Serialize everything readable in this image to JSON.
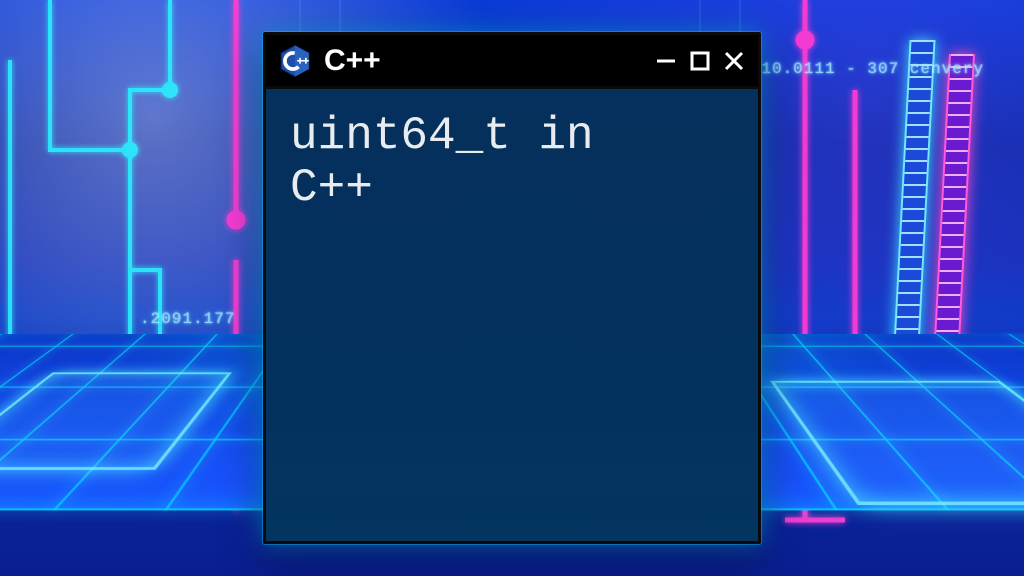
{
  "window": {
    "title": "C++",
    "content_line1": "uint64_t in",
    "content_line2": "C++",
    "icon_name": "cpp-logo-icon"
  },
  "controls": {
    "minimize_name": "minimize-icon",
    "maximize_name": "maximize-icon",
    "close_name": "close-icon"
  },
  "background": {
    "label_left": ".2091.177",
    "label_right": "10.0111 - 307  cenvery",
    "accent_cyan": "#2af1ff",
    "accent_magenta": "#ff3bd3"
  }
}
